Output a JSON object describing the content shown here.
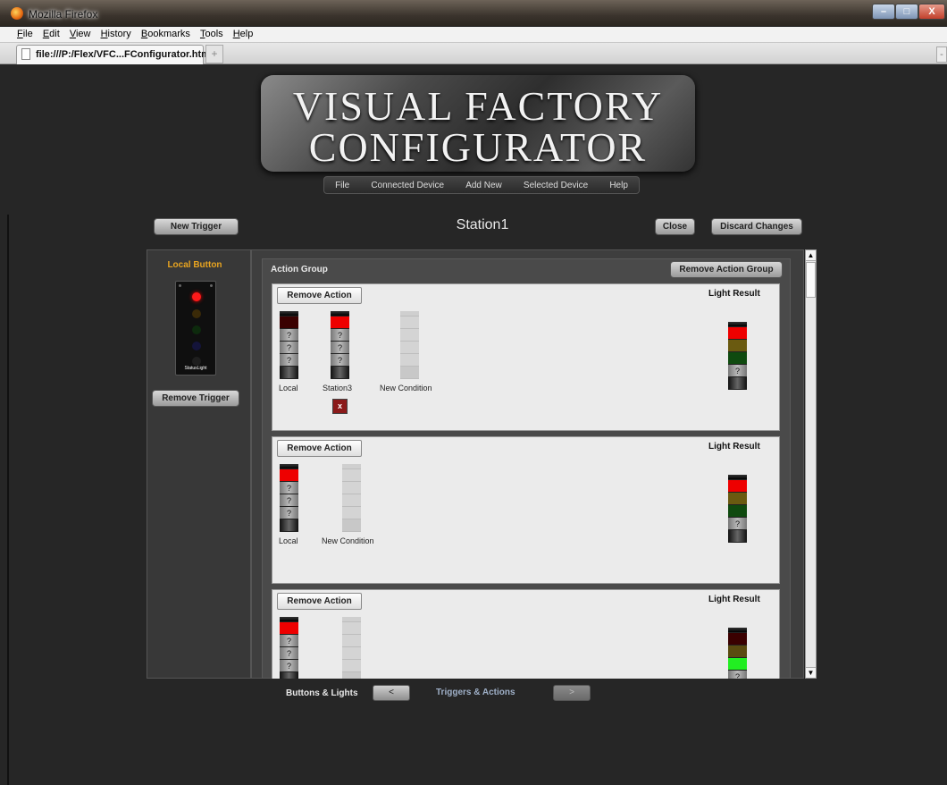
{
  "window": {
    "title": "Mozilla Firefox",
    "tab_label": "file:///P:/Flex/VFC...FConfigurator.html",
    "newtab_symbol": "+",
    "min_symbol": "–",
    "max_symbol": "□",
    "close_symbol": "X"
  },
  "menubar": [
    "File",
    "Edit",
    "View",
    "History",
    "Bookmarks",
    "Tools",
    "Help"
  ],
  "app": {
    "logo_line1": "VISUAL FACTORY",
    "logo_line2": "CONFIGURATOR",
    "menu": [
      "File",
      "Connected Device",
      "Add New",
      "Selected Device",
      "Help"
    ],
    "new_trigger_label": "New Trigger",
    "station_title": "Station1",
    "close_label": "Close",
    "discard_label": "Discard Changes"
  },
  "left_panel": {
    "title": "Local Button",
    "device_label": "StatusLight",
    "remove_trigger_label": "Remove Trigger"
  },
  "action_group": {
    "title": "Action Group",
    "remove_group_label": "Remove Action Group",
    "actions": [
      {
        "remove_label": "Remove Action",
        "result_label": "Light Result",
        "conditions": [
          {
            "label": "Local",
            "top": "#3a0000",
            "q": [
              "?",
              "?",
              "?"
            ]
          },
          {
            "label": "Station3",
            "top": "#ee0000",
            "q": [
              "?",
              "?",
              "?"
            ],
            "remove": "x"
          }
        ],
        "new_condition_label": "New Condition",
        "result_colors": [
          "#ee0000",
          "#6a5a10",
          "#0f4a0f"
        ],
        "result_q": "?"
      },
      {
        "remove_label": "Remove Action",
        "result_label": "Light Result",
        "conditions": [
          {
            "label": "Local",
            "top": "#ee0000",
            "q": [
              "?",
              "?",
              "?"
            ]
          }
        ],
        "new_condition_label": "New Condition",
        "result_colors": [
          "#ee0000",
          "#6a5a10",
          "#0f4a0f"
        ],
        "result_q": "?"
      },
      {
        "remove_label": "Remove Action",
        "result_label": "Light Result",
        "conditions": [
          {
            "label": "",
            "top": "#ee0000",
            "q": [
              "?",
              "?",
              "?"
            ]
          }
        ],
        "new_condition_label": "",
        "result_colors": [
          "#3a0000",
          "#5a4a10",
          "#22ee22"
        ],
        "result_q": "?"
      }
    ]
  },
  "bottom_nav": {
    "buttons_lights": "Buttons & Lights",
    "prev_symbol": "<",
    "triggers_actions": "Triggers & Actions",
    "next_symbol": ">"
  },
  "scroll": {
    "up_symbol": "▲",
    "down_symbol": "▼"
  }
}
